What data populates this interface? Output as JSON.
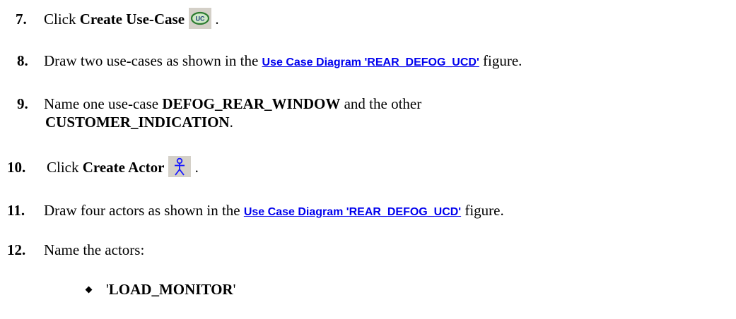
{
  "steps": [
    {
      "num": "7.",
      "pre": "Click ",
      "bold": "Create Use-Case",
      "post": " .",
      "icon": "use-case-icon",
      "icon_label": "UC"
    },
    {
      "num": "8.",
      "pre": "Draw two use-cases as shown in the ",
      "link": "Use Case Diagram 'REAR_DEFOG_UCD'",
      "post": " figure."
    },
    {
      "num": "9.",
      "pre": "Name one use-case ",
      "bold1": "DEFOG_REAR_WINDOW",
      "mid": " and the other",
      "bold2": "CUSTOMER_INDICATION",
      "post": "."
    },
    {
      "num": "10.",
      "pre": "Click ",
      "bold": "Create Actor",
      "post": " .",
      "icon": "actor-icon"
    },
    {
      "num": "11.",
      "pre": "Draw four actors as shown in the ",
      "link": "Use Case Diagram 'REAR_DEFOG_UCD'",
      "post": " figure."
    },
    {
      "num": "12.",
      "pre": "Name the actors:"
    }
  ],
  "bullets": [
    {
      "open": "'",
      "bold": "LOAD_MONITOR",
      "close": "'"
    }
  ],
  "colors": {
    "link": "#0000ee",
    "icon_bg": "#d4d0c8",
    "uc_icon": "#2e7d32",
    "actor_icon": "#1a1aff"
  }
}
